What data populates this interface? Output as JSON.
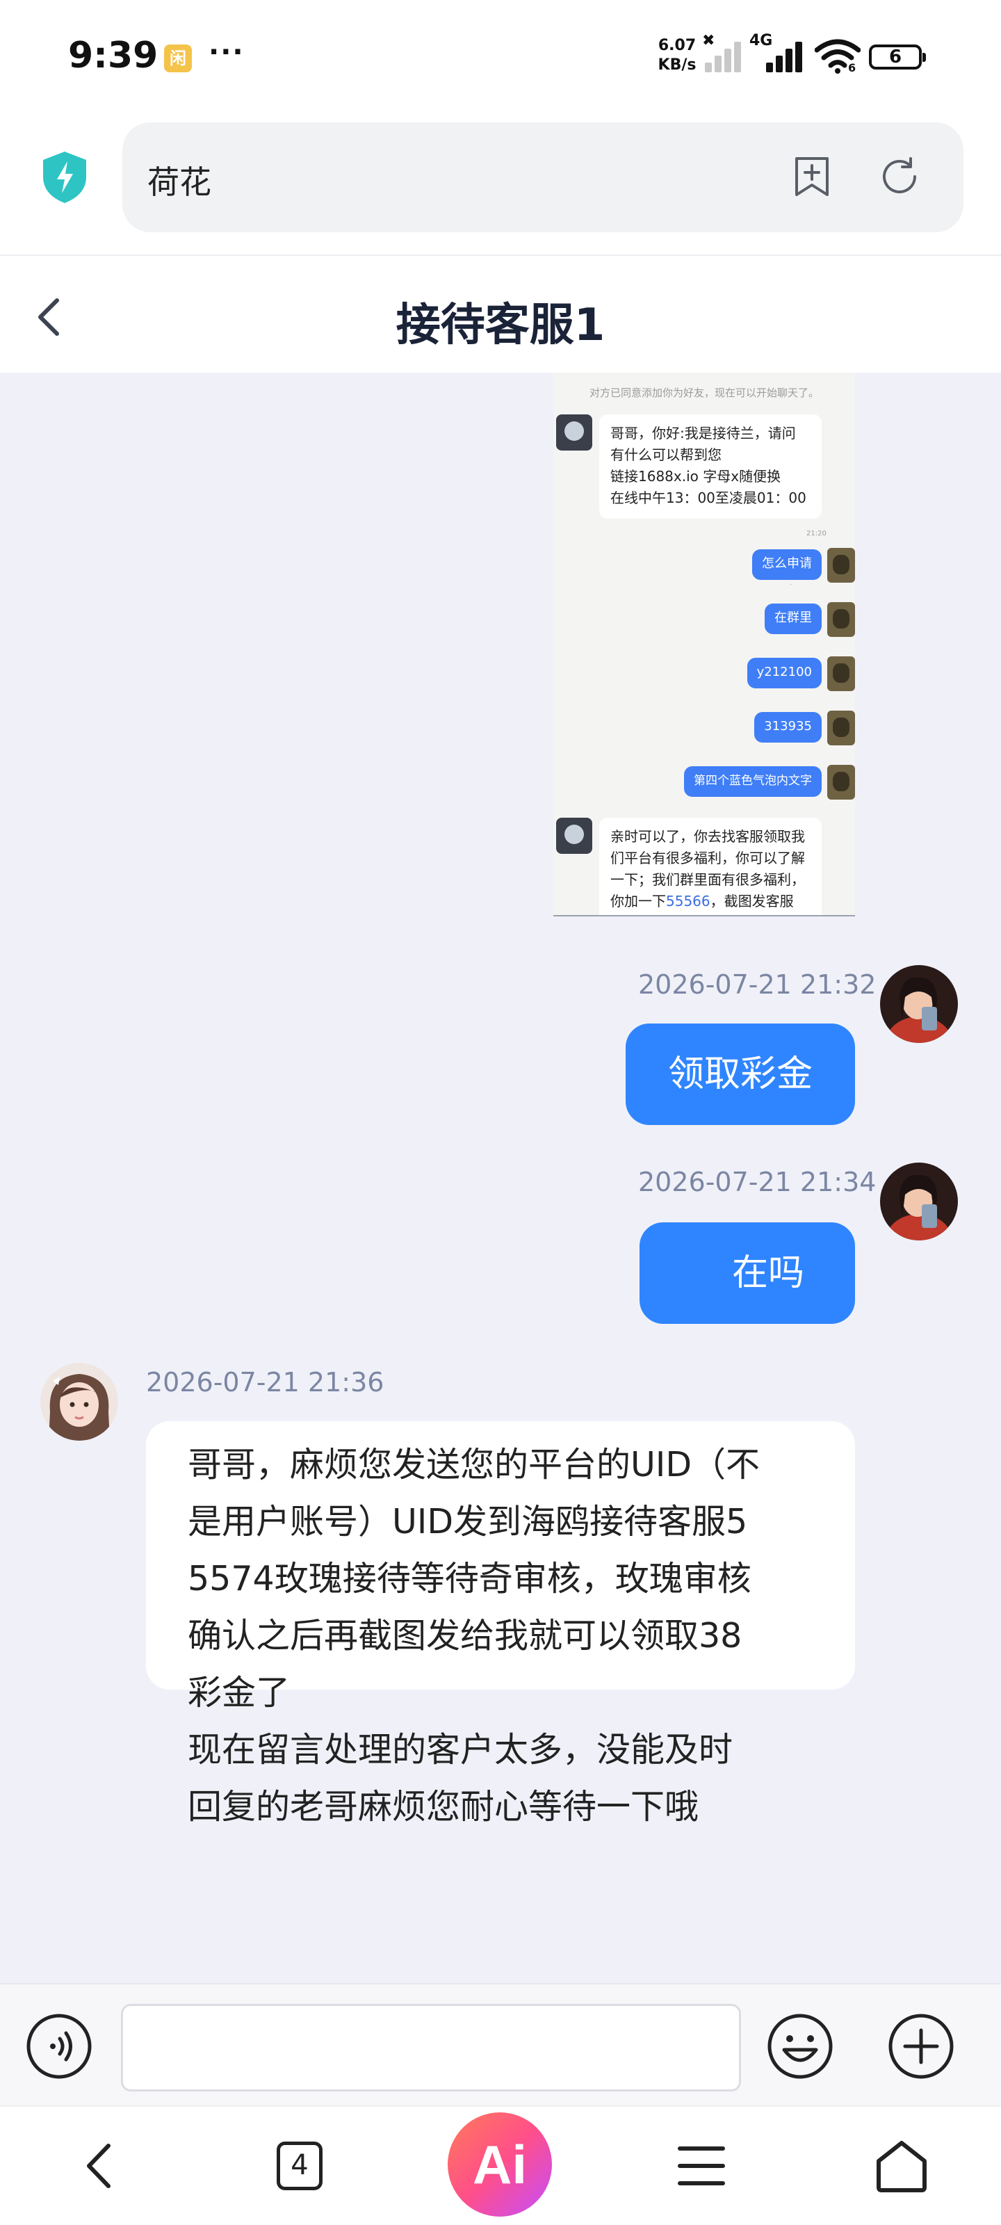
{
  "status_bar": {
    "time": "9:39",
    "badge": "闲",
    "dots": "···",
    "net_speed_value": "6.07",
    "net_speed_unit": "KB/s",
    "network": "4G",
    "wifi_label": "6",
    "battery": "6"
  },
  "browser": {
    "address_text": "荷花"
  },
  "chat": {
    "title": "接待客服1"
  },
  "screenshot": {
    "system_note": "对方已同意添加你为好友，现在可以开始聊天了。",
    "first_message_lines": [
      "哥哥，你好:我是接待兰，请问",
      "有什么可以帮到您",
      "链接1688x.io 字母x随便换",
      "在线中午13：00至凌晨01：00"
    ],
    "first_message_time": "21:20",
    "blue_bubbles": [
      "怎么申请",
      "在群里",
      "y212100",
      "313935",
      "第四个蓝色气泡内文字"
    ],
    "last_message_lines_a": [
      "亲时可以了，你去找客服领取我",
      "们平台有很多福利，你可以了解",
      "一下；我们群里面有很多福利，"
    ],
    "last_message_prefix": "你加一下",
    "last_message_link": "55566",
    "last_message_suffix": "，截图发客服"
  },
  "messages": [
    {
      "time": "2026-07-21 21:32",
      "text": "领取彩金",
      "sender": "me"
    },
    {
      "time": "2026-07-21 21:34",
      "text": "在吗",
      "sender": "me"
    },
    {
      "time": "2026-07-21 21:36",
      "sender": "agent",
      "lines": [
        "哥哥，麻烦您发送您的平台的UID（不",
        "是用户账号）UID发到海鸥接待客服5",
        "5574玫瑰接待等待奇审核，玫瑰审核",
        "确认之后再截图发给我就可以领取38",
        "彩金了",
        "现在留言处理的客户太多，没能及时",
        "回复的老哥麻烦您耐心等待一下哦"
      ]
    }
  ],
  "input": {
    "value": "",
    "placeholder": ""
  },
  "bottom_nav": {
    "tabs_count": "4",
    "ai_label": "Ai"
  },
  "colors": {
    "accent_blue": "#2f85ff",
    "chat_background": "#f0f1f8",
    "title_text": "#1a2338",
    "timestamp_text": "#7b86a3",
    "shield_teal": "#2ec4c4"
  }
}
